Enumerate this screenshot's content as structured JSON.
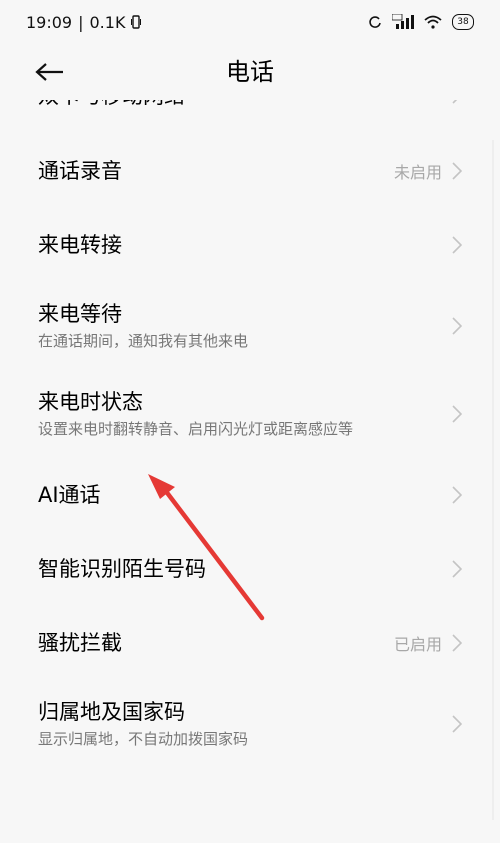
{
  "status": {
    "time": "19:09",
    "net_speed": "0.1K",
    "battery": "38"
  },
  "header": {
    "title": "电话"
  },
  "rows": [
    {
      "title": "双卡与移动网络",
      "sub": "",
      "value": ""
    },
    {
      "title": "通话录音",
      "sub": "",
      "value": "未启用"
    },
    {
      "title": "来电转接",
      "sub": "",
      "value": ""
    },
    {
      "title": "来电等待",
      "sub": "在通话期间，通知我有其他来电",
      "value": ""
    },
    {
      "title": "来电时状态",
      "sub": "设置来电时翻转静音、启用闪光灯或距离感应等",
      "value": ""
    },
    {
      "title": "AI通话",
      "sub": "",
      "value": ""
    },
    {
      "title": "智能识别陌生号码",
      "sub": "",
      "value": ""
    },
    {
      "title": "骚扰拦截",
      "sub": "",
      "value": "已启用"
    },
    {
      "title": "归属地及国家码",
      "sub": "显示归属地，不自动加拨国家码",
      "value": ""
    },
    {
      "title": "",
      "sub": "",
      "value": ""
    }
  ],
  "colors": {
    "annotation_arrow": "#e53935"
  }
}
